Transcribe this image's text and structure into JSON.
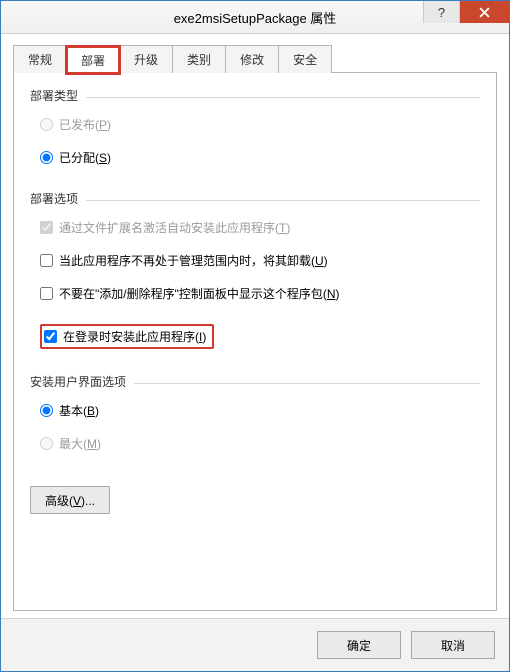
{
  "window": {
    "title": "exe2msiSetupPackage 属性"
  },
  "tabs": {
    "general": "常规",
    "deploy": "部署",
    "upgrade": "升级",
    "category": "类别",
    "modify": "修改",
    "security": "安全"
  },
  "deploy": {
    "type_group": "部署类型",
    "published": "已发布(P)",
    "assigned": "已分配(S)",
    "options_group": "部署选项",
    "opt_autoinstall": "通过文件扩展名激活自动安装此应用程序(T)",
    "opt_uninstall_out_of_scope": "当此应用程序不再处于管理范围内时，将其卸载(U)",
    "opt_hide_addremove": "不要在\"添加/删除程序\"控制面板中显示这个程序包(N)",
    "opt_install_at_logon": "在登录时安装此应用程序(I)",
    "ui_group": "安装用户界面选项",
    "ui_basic": "基本(B)",
    "ui_max": "最大(M)",
    "advanced": "高级(V)..."
  },
  "footer": {
    "ok": "确定",
    "cancel": "取消"
  }
}
